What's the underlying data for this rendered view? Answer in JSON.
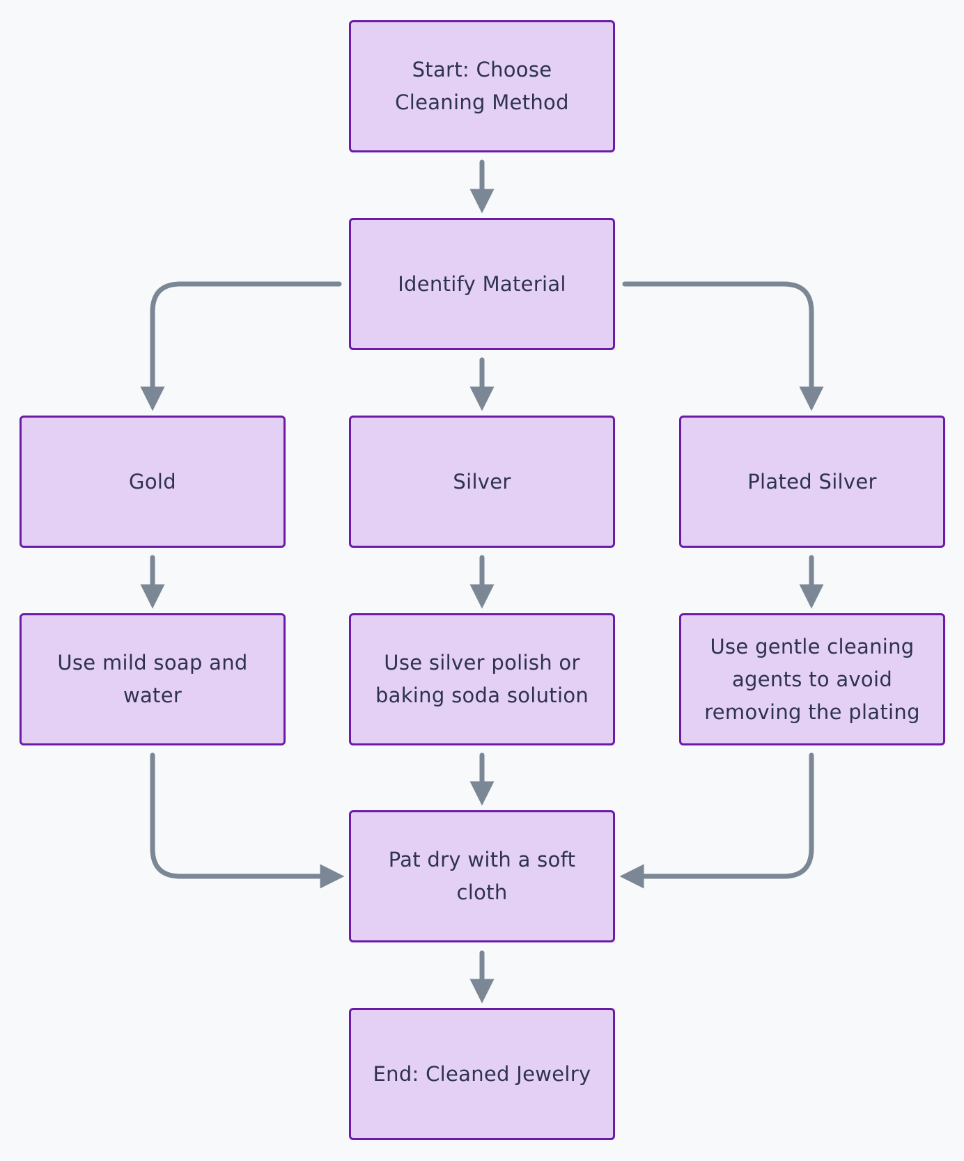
{
  "diagram": {
    "type": "flowchart",
    "colors": {
      "background": "#f7f9fb",
      "node_fill": "#e4d0f4",
      "node_border": "#6b1ba8",
      "edge": "#7b8794",
      "text": "#2e3250"
    },
    "nodes": {
      "start": {
        "label": "Start: Choose Cleaning Method"
      },
      "identify": {
        "label": "Identify Material"
      },
      "gold": {
        "label": "Gold"
      },
      "silver": {
        "label": "Silver"
      },
      "plated": {
        "label": "Plated Silver"
      },
      "gold_clean": {
        "label": "Use mild soap and water"
      },
      "silver_clean": {
        "label": "Use silver polish or baking soda solution"
      },
      "plated_clean": {
        "label": "Use gentle cleaning agents to avoid removing the plating"
      },
      "dry": {
        "label": "Pat dry with a soft cloth"
      },
      "end": {
        "label": "End: Cleaned Jewelry"
      }
    },
    "edges": [
      {
        "from": "start",
        "to": "identify"
      },
      {
        "from": "identify",
        "to": "gold"
      },
      {
        "from": "identify",
        "to": "silver"
      },
      {
        "from": "identify",
        "to": "plated"
      },
      {
        "from": "gold",
        "to": "gold_clean"
      },
      {
        "from": "silver",
        "to": "silver_clean"
      },
      {
        "from": "plated",
        "to": "plated_clean"
      },
      {
        "from": "gold_clean",
        "to": "dry"
      },
      {
        "from": "silver_clean",
        "to": "dry"
      },
      {
        "from": "plated_clean",
        "to": "dry"
      },
      {
        "from": "dry",
        "to": "end"
      }
    ]
  }
}
